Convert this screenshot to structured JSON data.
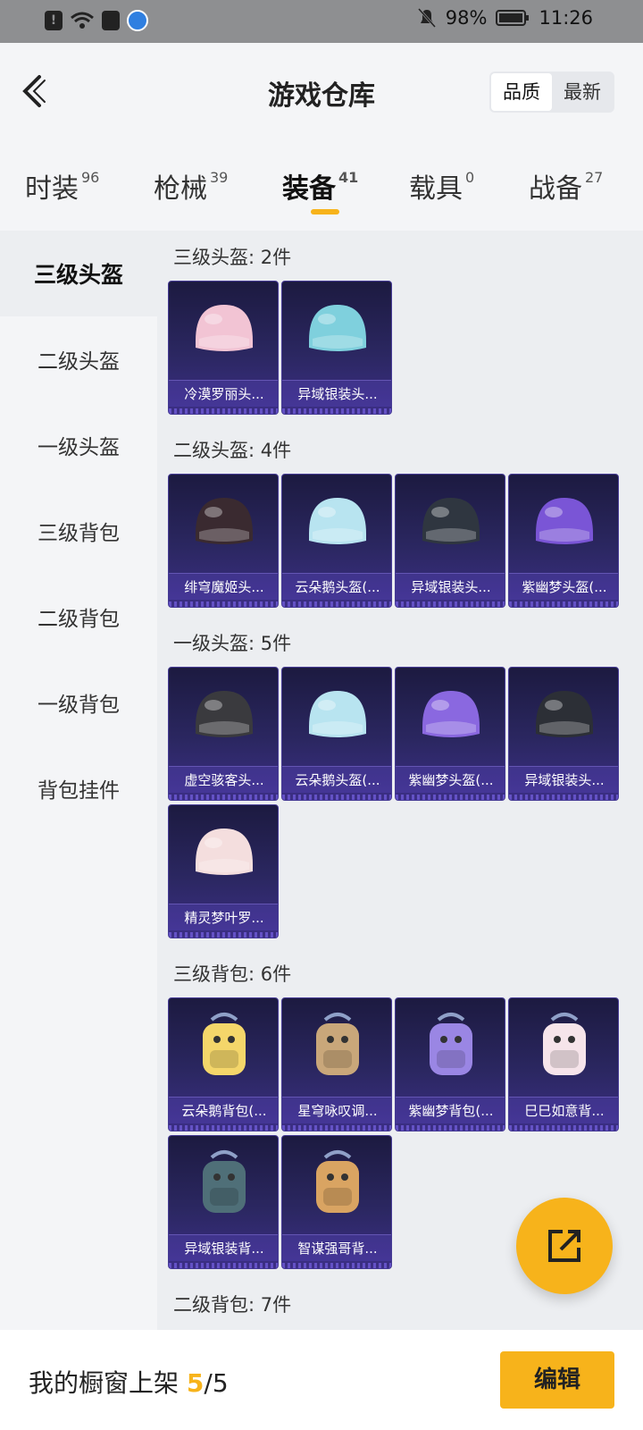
{
  "status_bar": {
    "battery": "98%",
    "time": "11:26",
    "icons": [
      "alert-icon",
      "wifi-icon",
      "message-icon",
      "globe-icon",
      "mute-bell-icon",
      "battery-icon"
    ]
  },
  "header": {
    "title": "游戏仓库",
    "sort": [
      {
        "label": "品质",
        "active": true
      },
      {
        "label": "最新",
        "active": false
      }
    ]
  },
  "tabs": [
    {
      "label": "时装",
      "count": "96"
    },
    {
      "label": "枪械",
      "count": "39"
    },
    {
      "label": "装备",
      "count": "41",
      "active": true
    },
    {
      "label": "载具",
      "count": "0"
    },
    {
      "label": "战备",
      "count": "27"
    }
  ],
  "sidebar": {
    "items": [
      "三级头盔",
      "二级头盔",
      "一级头盔",
      "三级背包",
      "二级背包",
      "一级背包",
      "背包挂件"
    ],
    "active": "三级头盔"
  },
  "sections": [
    {
      "title": "三级头盔: 2件",
      "items": [
        {
          "label": "冷漠罗丽头...",
          "icon": "helmet-icon",
          "color": "#f2c4d4"
        },
        {
          "label": "异域银装头...",
          "icon": "helmet-icon",
          "color": "#7fd0dd"
        }
      ]
    },
    {
      "title": "二级头盔: 4件",
      "items": [
        {
          "label": "绯穹魔姬头...",
          "icon": "helmet-icon",
          "color": "#3a2a30"
        },
        {
          "label": "云朵鹅头盔(...",
          "icon": "helmet-icon",
          "color": "#b8e4f0"
        },
        {
          "label": "异域银装头...",
          "icon": "helmet-icon",
          "color": "#2f3640"
        },
        {
          "label": "紫幽梦头盔(...",
          "icon": "helmet-icon",
          "color": "#7a55d6"
        }
      ]
    },
    {
      "title": "一级头盔: 5件",
      "items": [
        {
          "label": "虚空骇客头...",
          "icon": "helmet-icon",
          "color": "#3a3a3e"
        },
        {
          "label": "云朵鹅头盔(...",
          "icon": "helmet-icon",
          "color": "#b8e4f0"
        },
        {
          "label": "紫幽梦头盔(...",
          "icon": "helmet-icon",
          "color": "#8a68e0"
        },
        {
          "label": "异域银装头...",
          "icon": "helmet-icon",
          "color": "#2c2f36"
        },
        {
          "label": "精灵梦叶罗...",
          "icon": "helmet-icon",
          "color": "#f4dede"
        }
      ]
    },
    {
      "title": "三级背包: 6件",
      "items": [
        {
          "label": "云朵鹅背包(...",
          "icon": "backpack-icon",
          "color": "#f4d66a"
        },
        {
          "label": "星穹咏叹调...",
          "icon": "backpack-icon",
          "color": "#c9a77a"
        },
        {
          "label": "紫幽梦背包(...",
          "icon": "backpack-icon",
          "color": "#9a86e4"
        },
        {
          "label": "巳巳如意背...",
          "icon": "backpack-icon",
          "color": "#f6e4ea"
        },
        {
          "label": "异域银装背...",
          "icon": "backpack-icon",
          "color": "#4f6f78"
        },
        {
          "label": "智谋强哥背...",
          "icon": "backpack-icon",
          "color": "#d9a462"
        }
      ]
    },
    {
      "title": "二级背包: 7件",
      "items": []
    }
  ],
  "bottom": {
    "label": "我的橱窗上架",
    "shown": "5",
    "total": "/5",
    "edit": "编辑"
  },
  "colors": {
    "accent": "#f7b31b",
    "card_bg": "#2b2761"
  }
}
